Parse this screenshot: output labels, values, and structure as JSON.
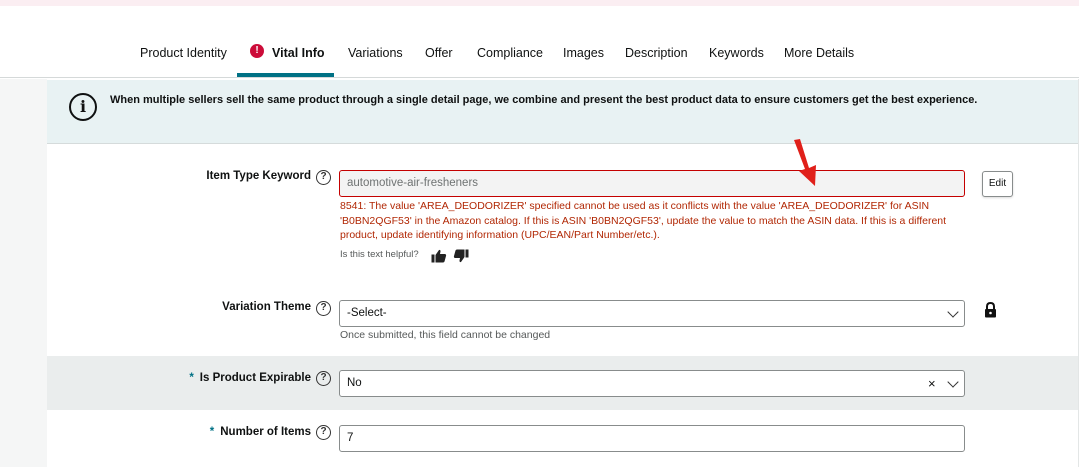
{
  "tabs": [
    {
      "label": "Product Identity"
    },
    {
      "label": "Vital Info",
      "active": true,
      "alert": "!"
    },
    {
      "label": "Variations"
    },
    {
      "label": "Offer"
    },
    {
      "label": "Compliance"
    },
    {
      "label": "Images"
    },
    {
      "label": "Description"
    },
    {
      "label": "Keywords"
    },
    {
      "label": "More Details"
    }
  ],
  "banner": {
    "icon": "info-icon",
    "icon_glyph": "i",
    "text": "When multiple sellers sell the same product through a single detail page, we combine and present the best product data to ensure customers get the best experience."
  },
  "fields": {
    "item_type": {
      "label": "Item Type Keyword",
      "value": "automotive-air-fresheners",
      "edit_label": "Edit",
      "error": "8541: The value 'AREA_DEODORIZER' specified cannot be used as it conflicts with the value 'AREA_DEODORIZER' for ASIN 'B0BN2QGF53' in the Amazon catalog. If this is ASIN 'B0BN2QGF53', update the value to match the ASIN data. If this is a different product, update identifying information (UPC/EAN/Part Number/etc.).",
      "helpful_prompt": "Is this text helpful?"
    },
    "variation_theme": {
      "label": "Variation Theme",
      "value": "-Select-",
      "hint": "Once submitted, this field cannot be changed"
    },
    "is_expirable": {
      "label": "Is Product Expirable",
      "required_mark": "*",
      "value": "No",
      "clear_glyph": "×"
    },
    "number_of_items": {
      "label": "Number of Items",
      "required_mark": "*",
      "value": "7"
    }
  },
  "help_glyph": "?",
  "colors": {
    "accent_teal": "#007185",
    "error_red": "#b12704",
    "alert_red": "#cc0c39",
    "banner_bg": "#e8f2f3",
    "annotation_arrow": "#e0201a"
  }
}
